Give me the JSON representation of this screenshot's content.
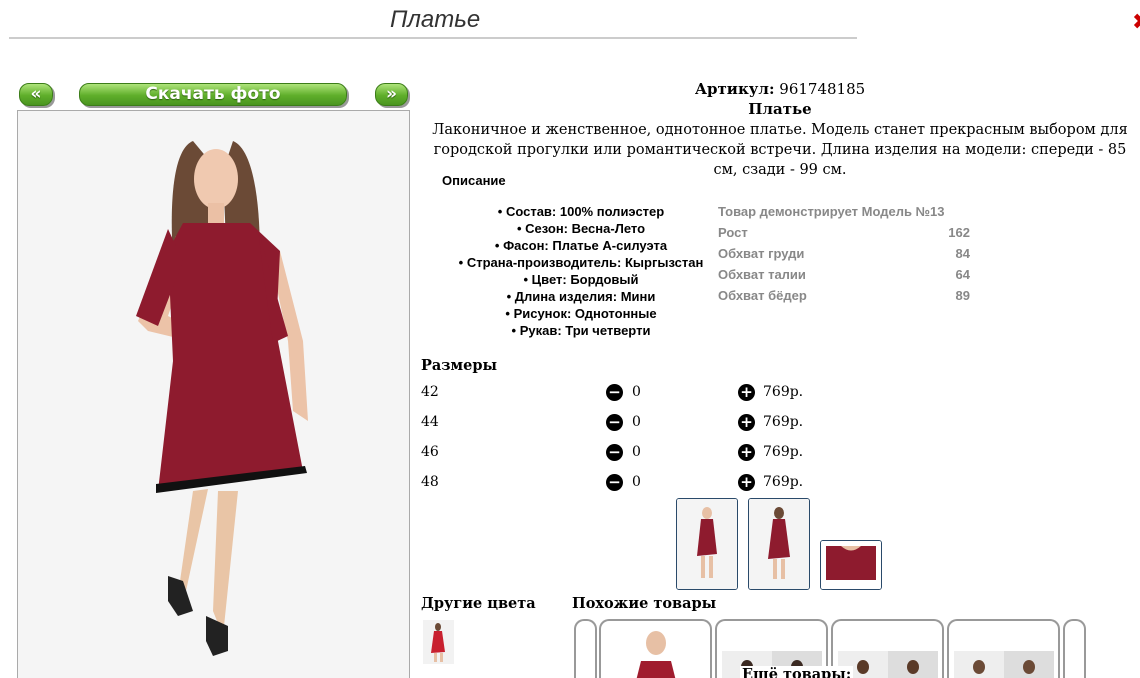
{
  "page": {
    "title": "Платье"
  },
  "gallery": {
    "prev_label": "«",
    "download_label": "Скачать фото",
    "next_label": "»"
  },
  "product": {
    "article_label": "Артикул:",
    "article_value": "961748185",
    "name": "Платье",
    "description": "Лаконичное и женственное, однотонное платье. Модель станет прекрасным выбором для городской прогулки или романтической встречи. Длина изделия на модели: спереди - 85 см, сзади - 99 см.",
    "description_heading": "Описание",
    "attributes": [
      "Состав: 100% полиэстер",
      "Сезон: Весна-Лето",
      "Фасон: Платье А-силуэта",
      "Страна-производитель: Кыргызстан",
      "Цвет: Бордовый",
      "Длина изделия: Мини",
      "Рисунок: Однотонные",
      "Рукав: Три четверти"
    ]
  },
  "model_info": {
    "heading": "Товар демонстрирует Модель №13",
    "rows": [
      {
        "label": "Рост",
        "value": "162"
      },
      {
        "label": "Обхват груди",
        "value": "84"
      },
      {
        "label": "Обхват талии",
        "value": "64"
      },
      {
        "label": "Обхват бёдер",
        "value": "89"
      }
    ]
  },
  "sizes": {
    "heading": "Размеры",
    "rows": [
      {
        "size": "42",
        "qty": "0",
        "price": "769р."
      },
      {
        "size": "44",
        "qty": "0",
        "price": "769р."
      },
      {
        "size": "46",
        "qty": "0",
        "price": "769р."
      },
      {
        "size": "48",
        "qty": "0",
        "price": "769р."
      }
    ]
  },
  "sections": {
    "other_colors": "Другие цвета",
    "similar": "Похожие товары",
    "more": "Ещё товары:"
  },
  "colors": {
    "dress": "#8e1b2e",
    "green_button": "#5fae2a",
    "accent_red": "#cc0000"
  }
}
